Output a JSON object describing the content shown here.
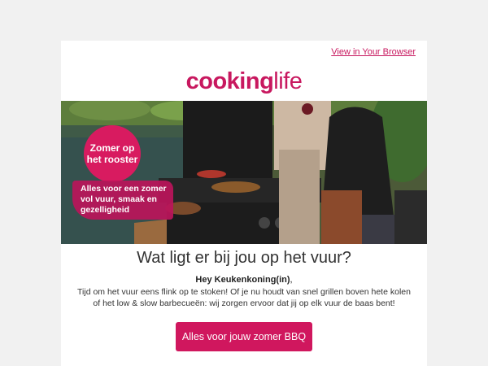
{
  "header": {
    "view_in_browser": "View in Your Browser"
  },
  "logo": {
    "part1": "cooking",
    "part2": "life"
  },
  "hero": {
    "badge_circle": "Zomer op\nhet rooster",
    "badge_box": "Alles voor een zomer\nvol vuur, smaak en\ngezelligheid"
  },
  "content": {
    "headline": "Wat ligt er bij jou op het vuur?",
    "greeting": "Hey Keukenkoning(in)",
    "greeting_punct": ",",
    "body": "Tijd om het vuur eens flink op te stoken! Of je nu houdt van snel grillen boven hete kolen of het low & slow barbecueën: wij zorgen ervoor dat jij op elk vuur de baas bent!",
    "cta": "Alles voor jouw zomer BBQ"
  },
  "colors": {
    "brand": "#c8185f",
    "cta_bg": "#d0175e",
    "page_bg": "#f1f1f1"
  }
}
